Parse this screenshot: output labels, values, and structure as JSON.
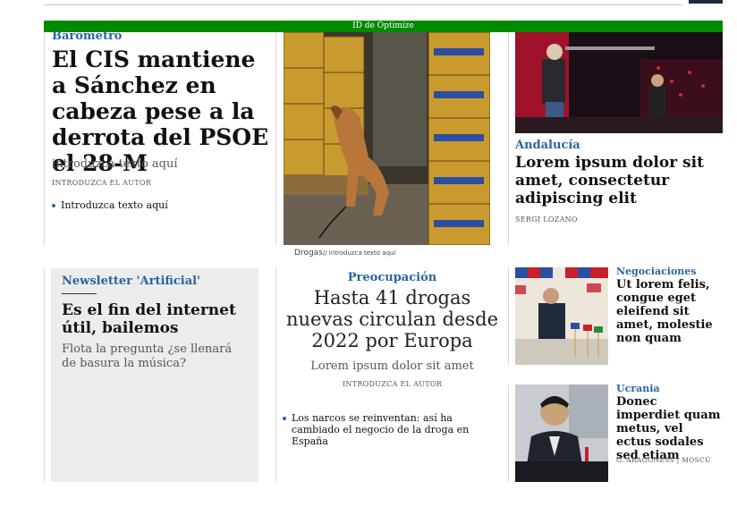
{
  "optimize_label": "ID de Optimize",
  "col1": {
    "kicker": "Barómetro",
    "headline": "El CIS mantiene a Sánchez en cabeza pese a la derrota del PSOE el 28-M",
    "subtitle": "introduzca texto aquí",
    "author": "INTRODUZCA EL AUTOR",
    "related": "Introduzca texto aquí"
  },
  "col2": {
    "caption_section": "Drogas",
    "caption_text": "// Introduzca texto aquí",
    "kicker": "Preocupación",
    "headline": "Hasta 41 drogas nuevas circulan desde 2022 por Europa",
    "subtitle": "Lorem ipsum dolor sit amet",
    "author": "INTRODUZCA EL AUTOR",
    "related": "Los narcos se reinventan: así ha cambiado el negocio de la droga en España"
  },
  "col3_top": {
    "kicker": "Andalucía",
    "headline": "Lorem ipsum dolor sit amet, consectetur adipiscing elit",
    "author": "SERGI LOZANO"
  },
  "newsletter": {
    "kicker": "Newsletter 'Artificial'",
    "headline": "Es el fin del internet útil, bailemos",
    "subtitle": "Flota la pregunta ¿se llenará de basura la música?"
  },
  "small1": {
    "kicker": "Negociaciones",
    "headline": "Ut lorem felis, congue eget eleifend sit amet, molestie non quam"
  },
  "small2": {
    "kicker": "Ucrania",
    "headline": "Donec imperdiet quam metus, vel ectus sodales sed etiam",
    "author": "G. ARAGONÈSS | MOSCÚ"
  }
}
